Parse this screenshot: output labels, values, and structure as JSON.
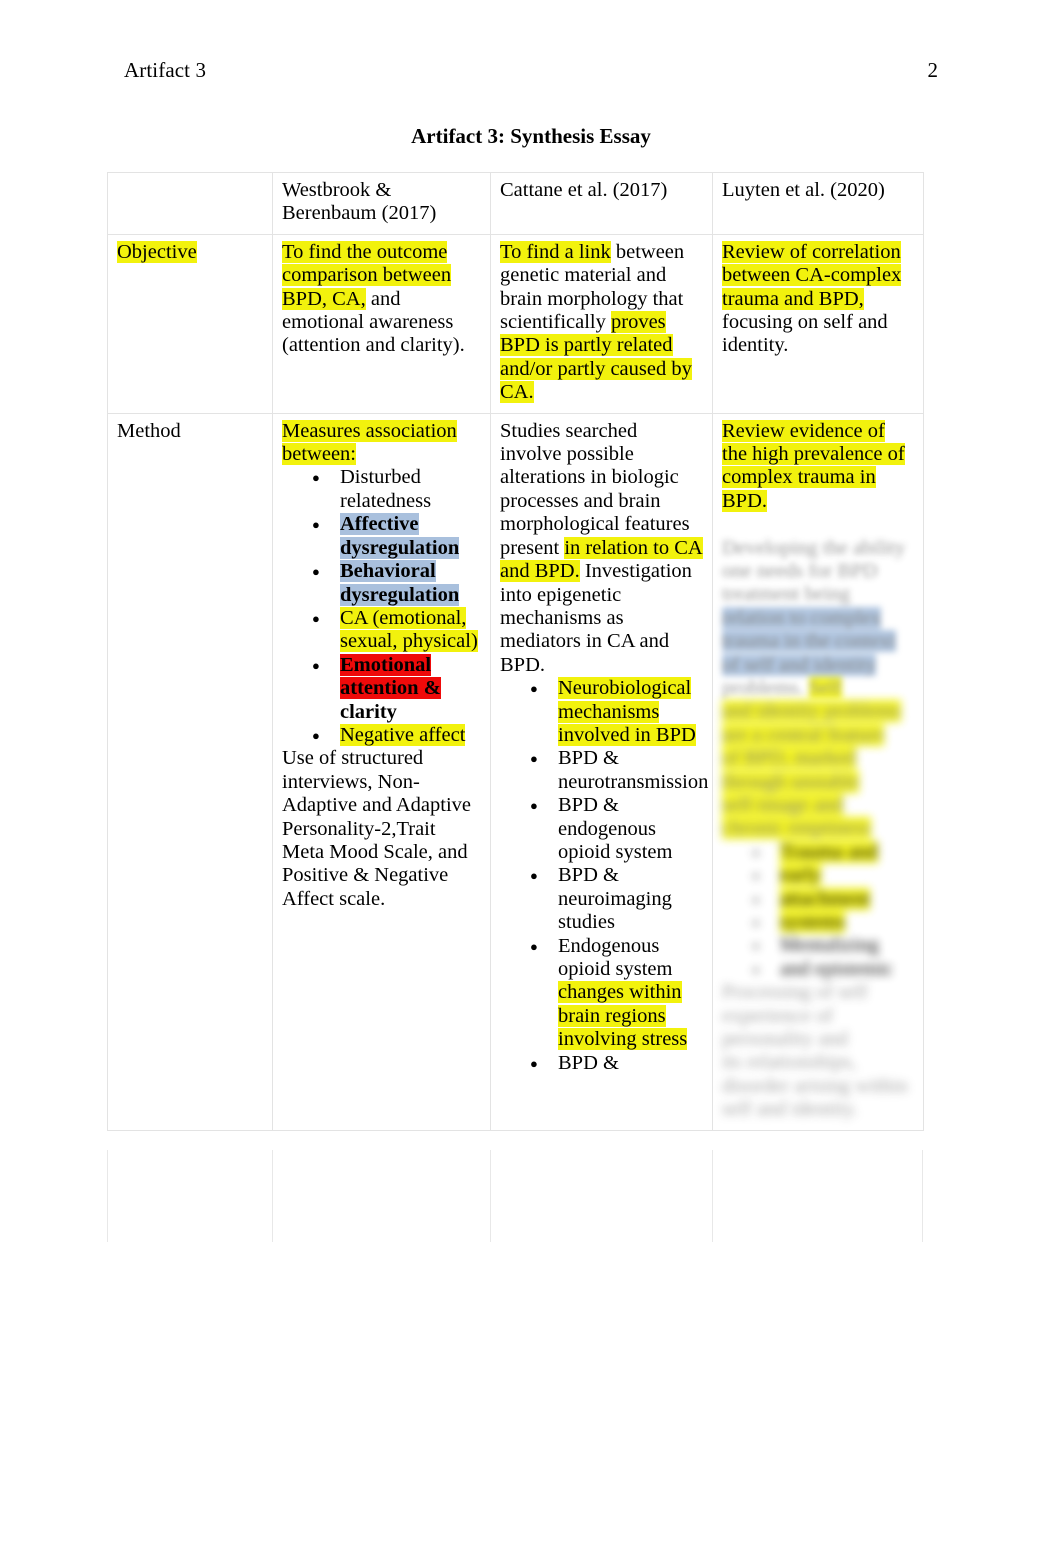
{
  "page": {
    "running_header_left": "Artifact 3",
    "page_number": "2",
    "title": "Artifact 3: Synthesis Essay"
  },
  "table": {
    "columns": [
      {
        "label": ""
      },
      {
        "label": "Westbrook & Berenbaum (2017)"
      },
      {
        "label": "Cattane et al. (2017)"
      },
      {
        "label": "Luyten et al. (2020)"
      }
    ],
    "rows": [
      {
        "label": "Objective",
        "label_highlight": "yellow",
        "westbrook": {
          "segments": [
            {
              "text": "To find the outcome comparison between BPD, CA,",
              "highlight": "yellow"
            },
            {
              "text": " and emotional awareness (attention and clarity).",
              "highlight": "none"
            }
          ]
        },
        "cattane": {
          "segments": [
            {
              "text": "To find a link",
              "highlight": "yellow"
            },
            {
              "text": " between genetic material and brain morphology that scientifically ",
              "highlight": "none"
            },
            {
              "text": "proves BPD is partly related and/or partly caused by CA.",
              "highlight": "yellow"
            }
          ]
        },
        "luyten": {
          "segments": [
            {
              "text": "Review of correlation between CA-complex trauma and BPD,",
              "highlight": "yellow"
            },
            {
              "text": " focusing on self and identity.",
              "highlight": "none"
            }
          ]
        }
      },
      {
        "label": "Method",
        "label_highlight": "none",
        "westbrook": {
          "intro": [
            {
              "text": "Measures association between:",
              "highlight": "yellow"
            }
          ],
          "bullets": [
            {
              "segments": [
                {
                  "text": "Disturbed relatedness",
                  "highlight": "none"
                }
              ]
            },
            {
              "segments": [
                {
                  "text": "Affective dysregulation",
                  "highlight": "blue",
                  "bold": true
                }
              ]
            },
            {
              "segments": [
                {
                  "text": "Behavioral dysregulation",
                  "highlight": "blue",
                  "bold": true
                }
              ]
            },
            {
              "segments": [
                {
                  "text": "CA (emotional, sexual, physical)",
                  "highlight": "yellow"
                }
              ]
            },
            {
              "segments": [
                {
                  "text": "Emotional attention &",
                  "highlight": "red",
                  "bold": true
                },
                {
                  "text": " clarity",
                  "highlight": "none",
                  "bold": true
                }
              ]
            },
            {
              "segments": [
                {
                  "text": "Negative affect",
                  "highlight": "yellow"
                }
              ]
            }
          ],
          "outro": [
            {
              "text": "Use of structured interviews, Non-Adaptive and Adaptive Personality-2,",
              "highlight": "none"
            },
            {
              "text": "Trait Meta Mood Scale, and Positive & Negative Affect scale.",
              "highlight": "none"
            }
          ]
        },
        "cattane": {
          "intro": [
            {
              "text": "Studies searched involve possible alterations in biologic processes and brain morphological features present ",
              "highlight": "none"
            },
            {
              "text": "in relation to CA and BPD.",
              "highlight": "yellow"
            },
            {
              "text": " Investigation into epigenetic mechanisms as mediators in CA and BPD.",
              "highlight": "none"
            }
          ],
          "bullets": [
            {
              "segments": [
                {
                  "text": "Neurobiological mechanisms involved in BPD",
                  "highlight": "yellow"
                }
              ]
            },
            {
              "segments": [
                {
                  "text": "BPD & neurotransmission",
                  "highlight": "none"
                }
              ]
            },
            {
              "segments": [
                {
                  "text": "BPD & endogenous opioid system",
                  "highlight": "none"
                }
              ]
            },
            {
              "segments": [
                {
                  "text": "BPD & neuroimaging studies",
                  "highlight": "none"
                }
              ]
            },
            {
              "segments": [
                {
                  "text": "Endogenous opioid system ",
                  "highlight": "none"
                },
                {
                  "text": "changes within brain regions involving stress",
                  "highlight": "yellow"
                }
              ]
            },
            {
              "segments": [
                {
                  "text": "BPD &",
                  "highlight": "none"
                }
              ]
            }
          ]
        },
        "luyten": {
          "intro": [
            {
              "text": "Review evidence of the high prevalence of complex trauma in BPD.",
              "highlight": "yellow"
            }
          ],
          "obscured": true,
          "obscured_note": "remaining content in this cell is blurred and illegible"
        }
      }
    ]
  },
  "colors": {
    "highlight_yellow": "#f2f20d",
    "highlight_blue": "#a9c0dd",
    "highlight_red": "#ef0a0a",
    "table_border": "#e3e3e3",
    "text": "#000000"
  }
}
